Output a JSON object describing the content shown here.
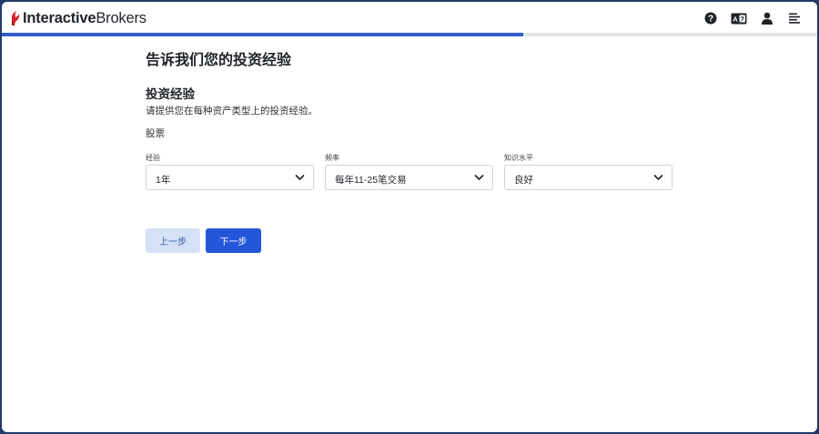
{
  "brand": {
    "name_bold": "Interactive",
    "name_regular": "Brokers",
    "logo_color": "#d81f26"
  },
  "header": {
    "icons": [
      "help-icon",
      "language-icon",
      "user-icon",
      "menu-icon"
    ]
  },
  "progress": {
    "fraction": 0.64,
    "color": "#2f5dc8"
  },
  "page": {
    "title": "告诉我们您的投资经验",
    "section_title": "投资经验",
    "subtitle": "请提供您在每种资产类型上的投资经验。",
    "asset_class": "股票"
  },
  "fields": [
    {
      "label": "经验",
      "value": "1年"
    },
    {
      "label": "频率",
      "value": "每年11-25笔交易"
    },
    {
      "label": "知识水平",
      "value": "良好"
    }
  ],
  "buttons": {
    "prev": "上一步",
    "next": "下一步"
  }
}
